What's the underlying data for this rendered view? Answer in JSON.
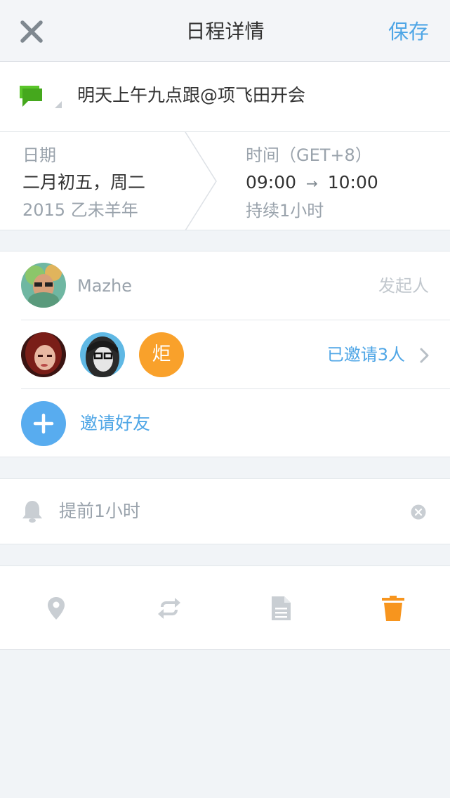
{
  "header": {
    "title": "日程详情",
    "save_label": "保存",
    "close_icon": "close-icon"
  },
  "event": {
    "title": "明天上午九点跟@项飞田开会",
    "icon": "chat-bubble-icon"
  },
  "date": {
    "label": "日期",
    "lunar": "二月初五，周二",
    "year": "2015 乙未羊年"
  },
  "time": {
    "label": "时间（GET+8）",
    "start": "09:00",
    "arrow": "→",
    "end": "10:00",
    "duration": "持续1小时"
  },
  "organizer": {
    "name": "Mazhe",
    "role": "发起人"
  },
  "invitees": {
    "avatar_initial": "炬",
    "summary": "已邀请3人"
  },
  "invite": {
    "label": "邀请好友"
  },
  "reminder": {
    "text": "提前1小时"
  },
  "actions": [
    {
      "icon": "location-pin-icon"
    },
    {
      "icon": "repeat-icon"
    },
    {
      "icon": "note-icon"
    },
    {
      "icon": "trash-icon"
    }
  ],
  "colors": {
    "accent": "#4fa6e6",
    "orange": "#f9a12b",
    "green": "#5ac52a",
    "muted": "#9aa3ac"
  }
}
